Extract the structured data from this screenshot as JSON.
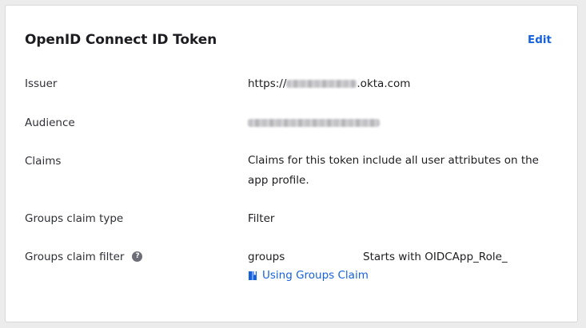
{
  "card": {
    "title": "OpenID Connect ID Token",
    "edit_label": "Edit"
  },
  "rows": {
    "issuer": {
      "label": "Issuer",
      "value_prefix": "https://",
      "value_suffix": ".okta.com"
    },
    "audience": {
      "label": "Audience"
    },
    "claims": {
      "label": "Claims",
      "value": "Claims for this token include all user attributes on the app profile."
    },
    "groups_claim_type": {
      "label": "Groups claim type",
      "value": "Filter"
    },
    "groups_claim_filter": {
      "label": "Groups claim filter",
      "help_glyph": "?",
      "claim_name": "groups",
      "filter_value": "Starts with OIDCApp_Role_",
      "link_label": "Using Groups Claim"
    }
  },
  "colors": {
    "accent": "#1662dd",
    "help_icon": "#6e6e78"
  },
  "icons": {
    "help": "question-circle-icon",
    "link": "book-icon"
  }
}
